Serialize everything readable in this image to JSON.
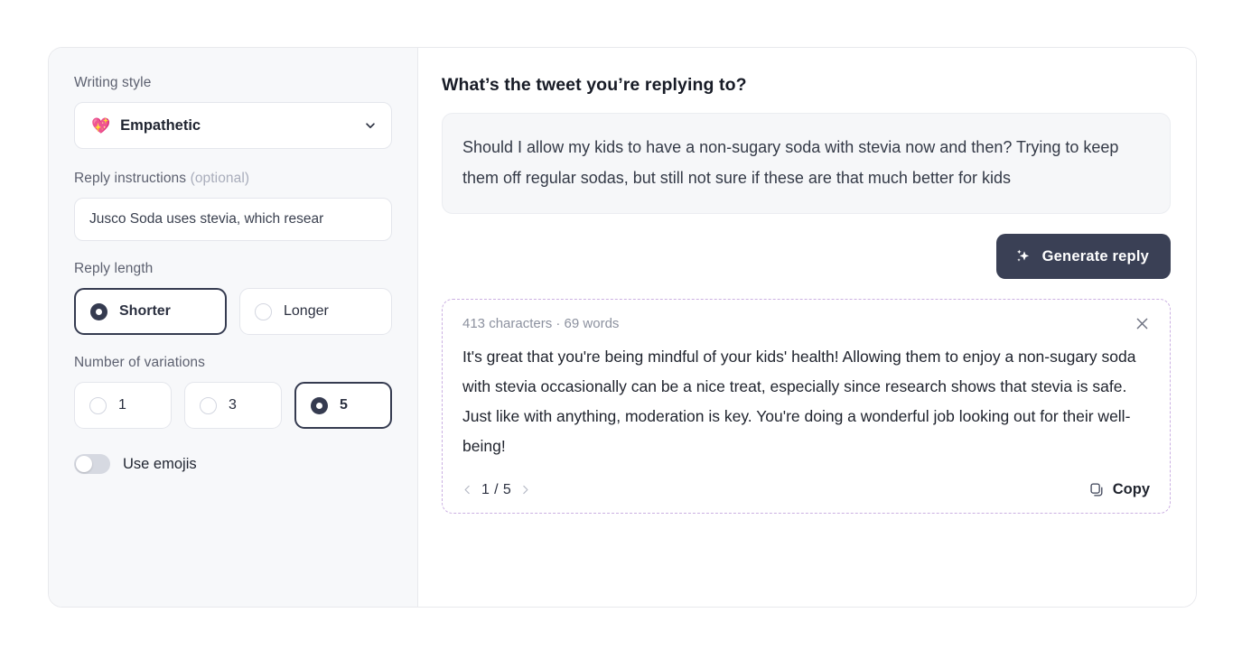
{
  "settings": {
    "writing_style": {
      "label": "Writing style",
      "emoji": "💖",
      "emoji_name": "sparkling-heart-emoji",
      "value": "Empathetic",
      "chevron_icon": "chevron-down-icon"
    },
    "reply_instructions": {
      "label": "Reply instructions",
      "optional_suffix": "(optional)",
      "value": "Jusco Soda uses stevia, which resear",
      "placeholder": "Reply instructions"
    },
    "reply_length": {
      "label": "Reply length",
      "options": [
        {
          "label": "Shorter",
          "selected": true
        },
        {
          "label": "Longer",
          "selected": false
        }
      ]
    },
    "variations": {
      "label": "Number of variations",
      "options": [
        {
          "label": "1",
          "selected": false
        },
        {
          "label": "3",
          "selected": false
        },
        {
          "label": "5",
          "selected": true
        }
      ]
    },
    "use_emojis": {
      "label": "Use emojis",
      "enabled": false
    }
  },
  "main": {
    "title": "What’s the tweet you’re replying to?",
    "tweet": "Should I allow my kids to have a non-sugary soda with stevia now and then? Trying to keep them off regular sodas, but still not sure if these are that much better for kids",
    "generate_button": {
      "label": "Generate reply",
      "icon": "sparkles-icon"
    },
    "result": {
      "meta": "413 characters · 69 words",
      "close_icon": "close-icon",
      "text": "It's great that you're being mindful of your kids' health! Allowing them to enjoy a non-sugary soda with stevia occasionally can be a nice treat, especially since research shows that stevia is safe. Just like with anything, moderation is key. You're doing a wonderful job looking out for their well-being!",
      "pagination": {
        "prev_icon": "chevron-left-icon",
        "next_icon": "chevron-right-icon",
        "counter": "1 / 5"
      },
      "copy": {
        "label": "Copy",
        "icon": "copy-icon"
      }
    }
  },
  "colors": {
    "accent_dark": "#3a4055",
    "panel_bg": "#f7f8fa",
    "result_border": "#cbb0e2",
    "tweet_bg": "#f6f7f9"
  }
}
